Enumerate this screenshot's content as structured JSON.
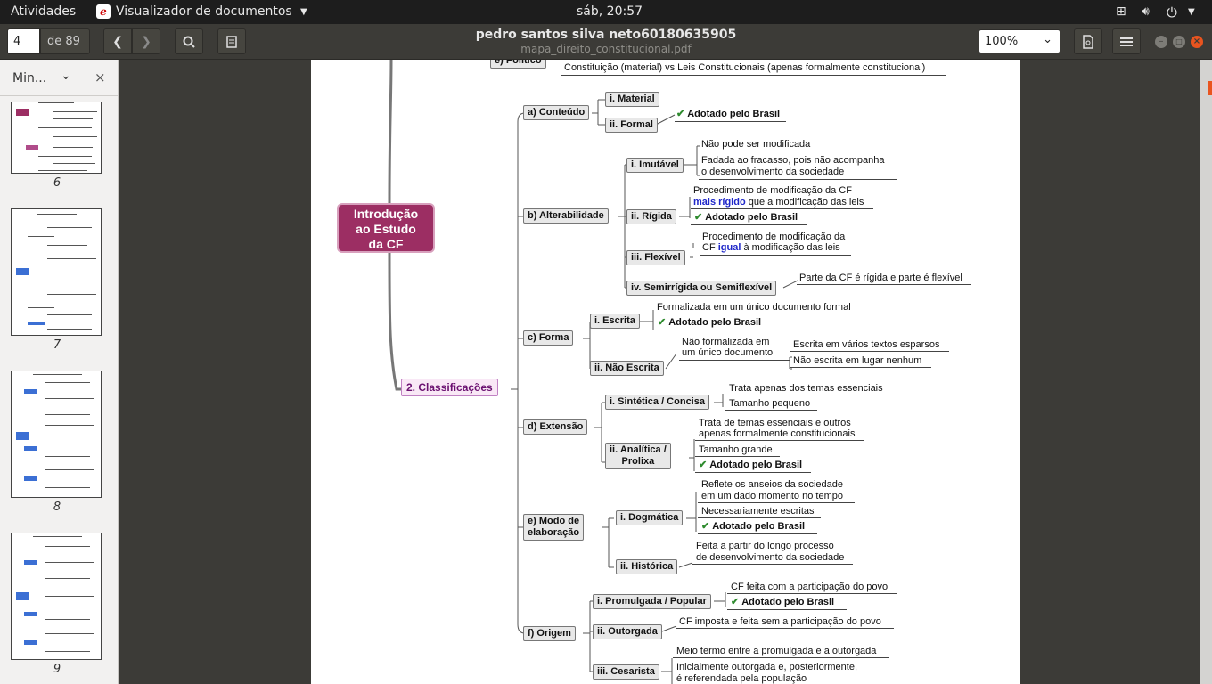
{
  "topbar": {
    "activities": "Atividades",
    "app_menu": "Visualizador de documentos",
    "clock": "sáb, 20:57"
  },
  "titlebar": {
    "page_input": "4",
    "page_total": "de 89",
    "title": "pedro santos silva neto60180635905",
    "subtitle": "mapa_direito_constitucional.pdf",
    "zoom": "100%"
  },
  "sidebar": {
    "mode_label": "Min...",
    "close": "×",
    "thumb_pages": [
      "6",
      "7",
      "8",
      "9"
    ]
  },
  "doc": {
    "cut_top_node": "e) Político",
    "cut_top_text": "Constituição (material) vs Leis Constitucionais (apenas formalmente constitucional)",
    "root": "Introdução\nao Estudo\nda CF",
    "classificacoes": "2. Classificações",
    "check": "✔",
    "adotado": "Adotado pelo Brasil",
    "a": {
      "label": "a) Conteúdo",
      "material": "i. Material",
      "formal": "ii. Formal"
    },
    "b": {
      "label": "b) Alterabilidade",
      "imutavel": "i. Imutável",
      "imut_t1": "Não pode ser modificada",
      "imut_t2a": "Fadada ao fracasso, pois não acompanha",
      "imut_t2b": "o desenvolvimento da sociedade",
      "rigida": "ii. Rígida",
      "rig_t1a": "Procedimento de modificação da CF",
      "rig_t1b_blue": "mais rígido",
      "rig_t1b_rest": " que a modificação das leis",
      "flexivel": "iii. Flexível",
      "flex_t1a": "Procedimento de modificação da",
      "flex_t1b_pre": "CF ",
      "flex_t1b_blue": "igual",
      "flex_t1b_rest": " à modificação das leis",
      "semi": "iv. Semirrígida ou Semiflexível",
      "semi_t1": "Parte da CF é rígida e parte é flexível"
    },
    "c": {
      "label": "c) Forma",
      "escrita": "i. Escrita",
      "esc_t1": "Formalizada em um único documento formal",
      "nao_escrita": "ii. Não Escrita",
      "ne_t1a": "Não formalizada em",
      "ne_t1b": "um único documento",
      "ne_t2": "Escrita em vários textos esparsos",
      "ne_t3": "Não escrita em lugar nenhum"
    },
    "d": {
      "label": "d) Extensão",
      "sintetica": "i. Sintética / Concisa",
      "sin_t1": "Trata apenas dos temas essenciais",
      "sin_t2": "Tamanho pequeno",
      "analitica_a": "ii. Analítica /",
      "analitica_b": "Prolixa",
      "ana_t1a": "Trata de temas essenciais e outros",
      "ana_t1b": "apenas formalmente constitucionais",
      "ana_t2": "Tamanho grande"
    },
    "e": {
      "label_a": "e) Modo de",
      "label_b": "elaboração",
      "dogmatica": "i. Dogmática",
      "dog_t1a": "Reflete os anseios da sociedade",
      "dog_t1b": "em um dado momento no tempo",
      "dog_t2": "Necessariamente escritas",
      "historica": "ii. Histórica",
      "his_t1a": "Feita a partir do longo processo",
      "his_t1b": "de desenvolvimento da sociedade"
    },
    "f": {
      "label": "f) Origem",
      "promulgada": "i. Promulgada / Popular",
      "pro_t1": "CF feita com a participação do povo",
      "outorgada": "ii. Outorgada",
      "out_t1": "CF imposta e feita sem a participação do povo",
      "cesarista": "iii. Cesarista",
      "ces_t1": "Meio termo entre a promulgada e a outorgada",
      "ces_t2a": "Inicialmente outorgada e, posteriormente,",
      "ces_t2b": "é referendada pela população"
    }
  }
}
